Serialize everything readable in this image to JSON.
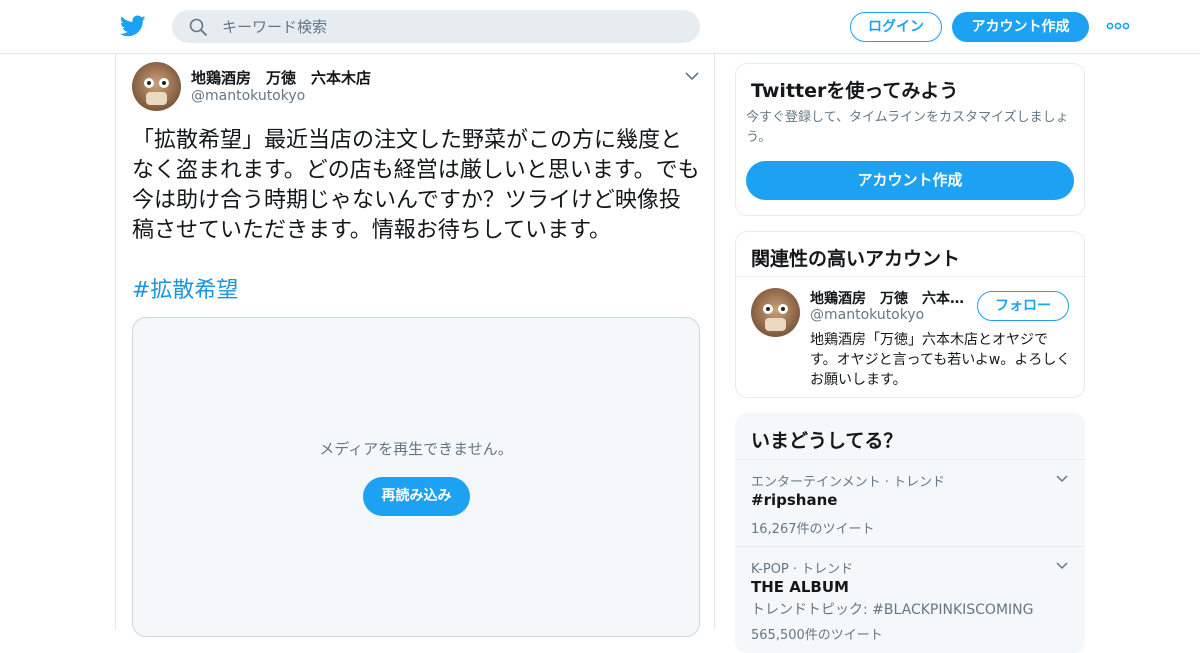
{
  "header": {
    "search_placeholder": "キーワード検索",
    "login_label": "ログイン",
    "signup_label": "アカウント作成",
    "brand_color": "#1da1f2"
  },
  "tweet": {
    "author_name": "地鶏酒房　万徳　六本木店",
    "author_handle": "@mantokutokyo",
    "text": "「拡散希望」最近当店の注文した野菜がこの方に幾度となく盗まれます。どの店も経営は厳しいと思います。でも今は助け合う時期じゃないんですか？ツライけど映像投稿させていただきます。情報お待ちしています。",
    "hashtag": "#拡散希望",
    "media": {
      "message": "メディアを再生できません。",
      "reload_label": "再読み込み"
    }
  },
  "sidebar": {
    "signup_card": {
      "title": "Twitterを使ってみよう",
      "description": "今すぐ登録して、タイムラインをカスタマイズしましょう。",
      "button_label": "アカウント作成"
    },
    "related": {
      "title": "関連性の高いアカウント",
      "account": {
        "name": "地鶏酒房　万徳　六本木店",
        "handle": "@mantokutokyo",
        "follow_label": "フォロー",
        "bio": "地鶏酒房「万徳」六本木店とオヤジです。オヤジと言っても若いよw。よろしくお願いします。"
      }
    },
    "trends": {
      "title": "いまどうしてる？",
      "items": [
        {
          "meta": "エンターテインメント · トレンド",
          "name": "#ripshane",
          "count": "16,267件のツイート"
        },
        {
          "meta": "K-POP · トレンド",
          "name": "THE ALBUM",
          "subtitle": "トレンドトピック: #BLACKPINKISCOMING",
          "count": "565,500件のツイート"
        }
      ]
    }
  }
}
